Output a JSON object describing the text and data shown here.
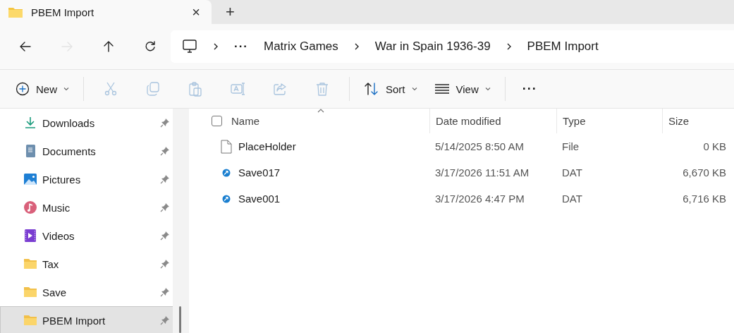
{
  "tab": {
    "title": "PBEM Import",
    "close": "×",
    "new_tab": "+"
  },
  "nav": [
    {
      "kind": "back",
      "disabled": false
    },
    {
      "kind": "forward",
      "disabled": true
    },
    {
      "kind": "up",
      "disabled": false
    },
    {
      "kind": "refresh",
      "disabled": false
    }
  ],
  "breadcrumb": {
    "overflow": "···",
    "items": [
      "Matrix Games",
      "War in Spain 1936-39",
      "PBEM Import"
    ]
  },
  "toolbar": {
    "new": {
      "label": "New"
    },
    "actions": [
      {
        "kind": "cut",
        "disabled": true
      },
      {
        "kind": "copy",
        "disabled": true
      },
      {
        "kind": "paste",
        "disabled": true
      },
      {
        "kind": "rename",
        "disabled": true
      },
      {
        "kind": "share",
        "disabled": true
      },
      {
        "kind": "delete",
        "disabled": true
      }
    ],
    "sort": {
      "label": "Sort"
    },
    "view": {
      "label": "View"
    },
    "more": "···"
  },
  "sidebar": {
    "items": [
      {
        "kind": "downloads",
        "label": "Downloads",
        "pinned": true,
        "selected": false
      },
      {
        "kind": "documents",
        "label": "Documents",
        "pinned": true,
        "selected": false
      },
      {
        "kind": "pictures",
        "label": "Pictures",
        "pinned": true,
        "selected": false
      },
      {
        "kind": "music",
        "label": "Music",
        "pinned": true,
        "selected": false
      },
      {
        "kind": "videos",
        "label": "Videos",
        "pinned": true,
        "selected": false
      },
      {
        "kind": "folder",
        "label": "Tax",
        "pinned": true,
        "selected": false
      },
      {
        "kind": "folder",
        "label": "Save",
        "pinned": true,
        "selected": false
      },
      {
        "kind": "folder",
        "label": "PBEM Import",
        "pinned": true,
        "selected": true
      }
    ]
  },
  "table": {
    "select_all": {
      "checked": false
    },
    "columns": [
      "Name",
      "Date modified",
      "Type",
      "Size"
    ],
    "rows": [
      {
        "kind": "file",
        "name": "PlaceHolder",
        "date": "5/14/2025 8:50 AM",
        "type": "File",
        "size": "0 KB"
      },
      {
        "kind": "dat",
        "name": "Save017",
        "date": "3/17/2026 11:51 AM",
        "type": "DAT",
        "size": "6,670 KB"
      },
      {
        "kind": "dat",
        "name": "Save001",
        "date": "3/17/2026 4:47 PM",
        "type": "DAT",
        "size": "6,716 KB"
      }
    ]
  }
}
